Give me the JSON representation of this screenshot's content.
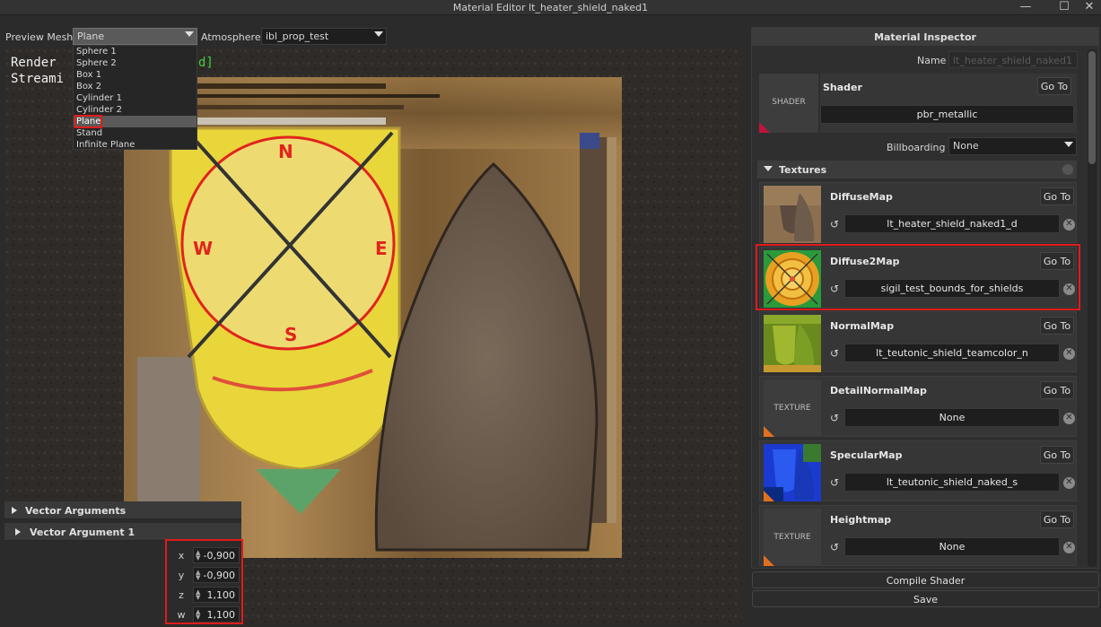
{
  "window": {
    "title": "Material Editor lt_heater_shield_naked1"
  },
  "toolbar": {
    "preview_mesh_label": "Preview Mesh",
    "preview_mesh_value": "Plane",
    "atmosphere_label": "Atmosphere",
    "atmosphere_value": "ibl_prop_test"
  },
  "mesh_options": [
    "Sphere 1",
    "Sphere 2",
    "Box 1",
    "Box 2",
    "Cylinder 1",
    "Cylinder 2",
    "Plane",
    "Stand",
    "Infinite Plane"
  ],
  "viewport": {
    "overlay_line1": "Render",
    "overlay_line2": "Streami",
    "overlay_green": "d]",
    "compass_n": "N",
    "compass_e": "E",
    "compass_s": "S",
    "compass_w": "W"
  },
  "vector_panel": {
    "header": "Vector Arguments",
    "sub_header": "Vector Argument 1",
    "rows": [
      {
        "label": "x",
        "value": "-0,900"
      },
      {
        "label": "y",
        "value": "-0,900"
      },
      {
        "label": "z",
        "value": "1,100"
      },
      {
        "label": "w",
        "value": "1,100"
      }
    ]
  },
  "inspector": {
    "title": "Material Inspector",
    "name_label": "Name",
    "name_value": "lt_heater_shield_naked1",
    "shader_label": "Shader",
    "shader_thumb": "SHADER",
    "shader_value": "pbr_metallic",
    "goto_label": "Go To",
    "billboarding_label": "Billboarding",
    "billboarding_value": "None",
    "textures_header": "Textures",
    "textures": [
      {
        "name": "DiffuseMap",
        "value": "lt_heater_shield_naked1_d",
        "thumb": ""
      },
      {
        "name": "Diffuse2Map",
        "value": "sigil_test_bounds_for_shields",
        "thumb": ""
      },
      {
        "name": "NormalMap",
        "value": "lt_teutonic_shield_teamcolor_n",
        "thumb": ""
      },
      {
        "name": "DetailNormalMap",
        "value": "None",
        "thumb": "TEXTURE"
      },
      {
        "name": "SpecularMap",
        "value": "lt_teutonic_shield_naked_s",
        "thumb": ""
      },
      {
        "name": "Heightmap",
        "value": "None",
        "thumb": "TEXTURE"
      }
    ]
  },
  "buttons": {
    "compile": "Compile Shader",
    "save": "Save"
  },
  "icons": {
    "minimize": "minimize-icon",
    "maximize": "maximize-icon",
    "close": "close-icon",
    "reset": "reset-icon",
    "clear": "clear-icon"
  }
}
